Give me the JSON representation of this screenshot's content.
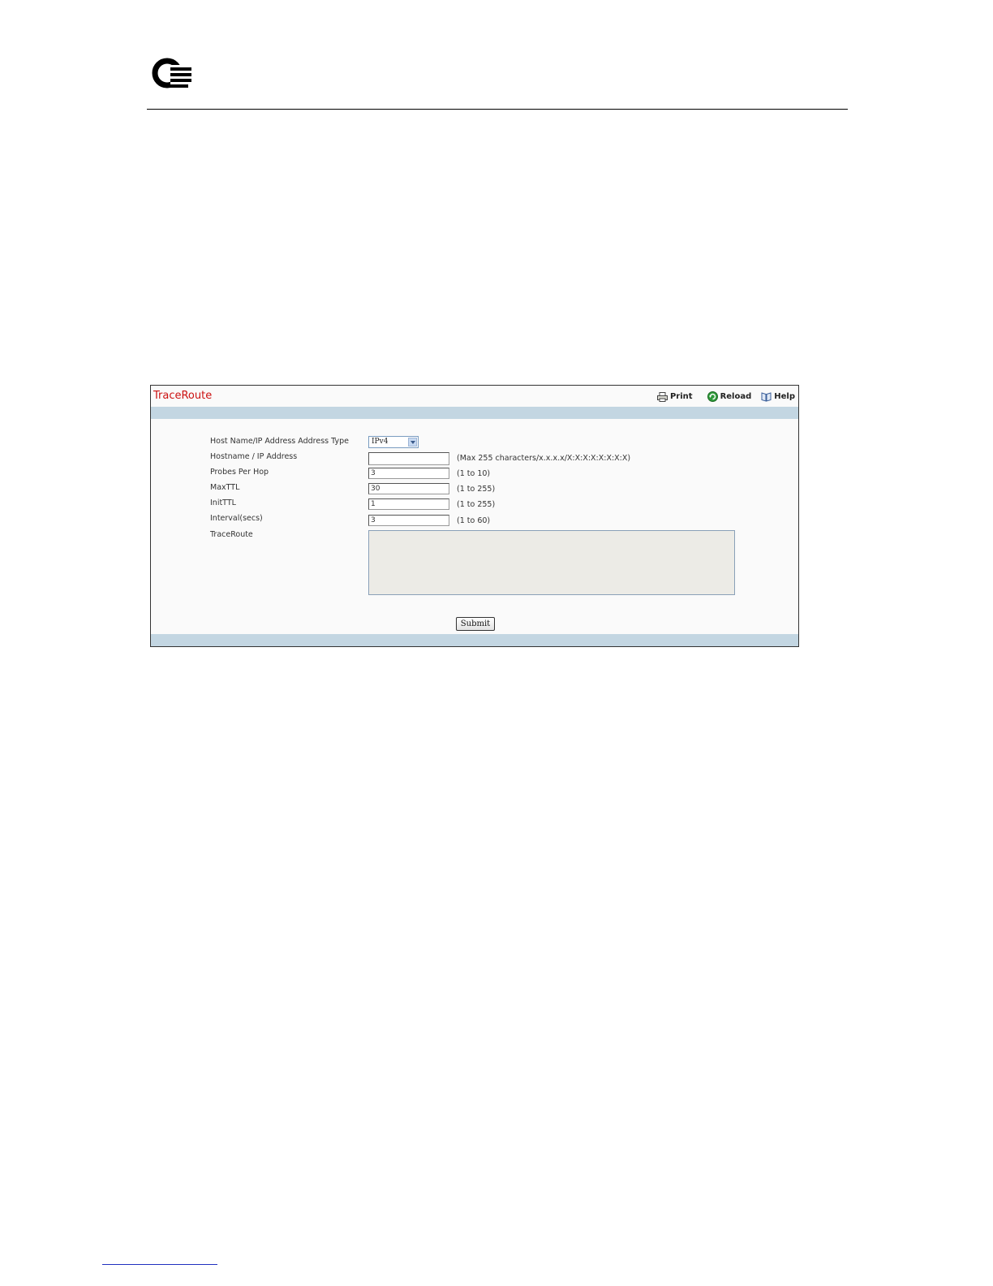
{
  "colors": {
    "title": "#cc1111",
    "band": "#c3d6e2",
    "textarea_bg": "#ecebe6"
  },
  "logo": {
    "icon": "qlogic-logo-icon"
  },
  "panel": {
    "title": "TraceRoute",
    "toolbar": {
      "print": {
        "label": "Print",
        "icon": "printer-icon"
      },
      "reload": {
        "label": "Reload",
        "icon": "reload-icon"
      },
      "help": {
        "label": "Help",
        "icon": "help-book-icon"
      }
    }
  },
  "form": {
    "address_type": {
      "label": "Host Name/IP Address Address Type",
      "value": "IPv4"
    },
    "hostname": {
      "label": "Hostname / IP Address",
      "value": "",
      "hint": "(Max 255 characters/x.x.x.x/X:X:X:X:X:X:X:X)"
    },
    "probes": {
      "label": "Probes Per Hop",
      "value": "3",
      "hint": "(1 to 10)"
    },
    "maxttl": {
      "label": "MaxTTL",
      "value": "30",
      "hint": "(1 to 255)"
    },
    "initttl": {
      "label": "InitTTL",
      "value": "1",
      "hint": "(1 to 255)"
    },
    "interval": {
      "label": "Interval(secs)",
      "value": "3",
      "hint": "(1 to 60)"
    },
    "traceroute": {
      "label": "TraceRoute",
      "value": ""
    },
    "submit_label": "Submit"
  }
}
